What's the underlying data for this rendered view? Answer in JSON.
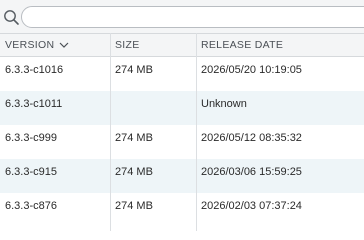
{
  "search": {
    "placeholder": "",
    "value": ""
  },
  "table": {
    "columns": [
      "VERSION",
      "SIZE",
      "RELEASE DATE"
    ],
    "sort_column": "VERSION",
    "rows": [
      {
        "version": "6.3.3-c1016",
        "size": "274 MB",
        "release_date": "2026/05/20 10:19:05"
      },
      {
        "version": "6.3.3-c1011",
        "size": "",
        "release_date": "Unknown"
      },
      {
        "version": "6.3.3-c999",
        "size": "274 MB",
        "release_date": "2026/05/12 08:35:32"
      },
      {
        "version": "6.3.3-c915",
        "size": "274 MB",
        "release_date": "2026/03/06 15:59:25"
      },
      {
        "version": "6.3.3-c876",
        "size": "274 MB",
        "release_date": "2026/02/03 07:37:24"
      }
    ]
  },
  "icons": {
    "search": "search-icon",
    "sort": "chevron-down-icon"
  },
  "colors": {
    "header_bg": "#f4f5f6",
    "alt_row_bg": "#eef5f8",
    "border": "#d6d9dc"
  }
}
